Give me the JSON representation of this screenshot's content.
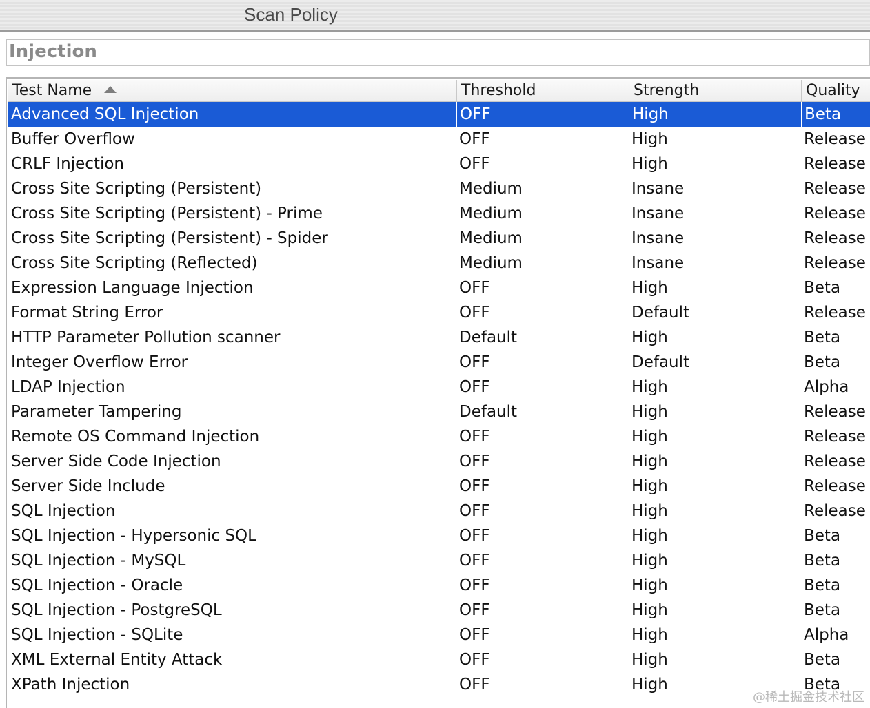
{
  "window": {
    "title": "Scan Policy"
  },
  "category": {
    "title": "Injection"
  },
  "table": {
    "columns": [
      "Test Name",
      "Threshold",
      "Strength",
      "Quality"
    ],
    "sort_icon": "sort-ascending-icon",
    "selected_row": 0,
    "rows": [
      [
        "Advanced SQL Injection",
        "OFF",
        "High",
        "Beta"
      ],
      [
        "Buffer Overflow",
        "OFF",
        "High",
        "Release"
      ],
      [
        "CRLF Injection",
        "OFF",
        "High",
        "Release"
      ],
      [
        "Cross Site Scripting (Persistent)",
        "Medium",
        "Insane",
        "Release"
      ],
      [
        "Cross Site Scripting (Persistent) - Prime",
        "Medium",
        "Insane",
        "Release"
      ],
      [
        "Cross Site Scripting (Persistent) - Spider",
        "Medium",
        "Insane",
        "Release"
      ],
      [
        "Cross Site Scripting (Reflected)",
        "Medium",
        "Insane",
        "Release"
      ],
      [
        "Expression Language Injection",
        "OFF",
        "High",
        "Beta"
      ],
      [
        "Format String Error",
        "OFF",
        "Default",
        "Release"
      ],
      [
        "HTTP Parameter Pollution scanner",
        "Default",
        "High",
        "Beta"
      ],
      [
        "Integer Overflow Error",
        "OFF",
        "Default",
        "Beta"
      ],
      [
        "LDAP Injection",
        "OFF",
        "High",
        "Alpha"
      ],
      [
        "Parameter Tampering",
        "Default",
        "High",
        "Release"
      ],
      [
        "Remote OS Command Injection",
        "OFF",
        "High",
        "Release"
      ],
      [
        "Server Side Code Injection",
        "OFF",
        "High",
        "Release"
      ],
      [
        "Server Side Include",
        "OFF",
        "High",
        "Release"
      ],
      [
        "SQL Injection",
        "OFF",
        "High",
        "Release"
      ],
      [
        "SQL Injection - Hypersonic SQL",
        "OFF",
        "High",
        "Beta"
      ],
      [
        "SQL Injection - MySQL",
        "OFF",
        "High",
        "Beta"
      ],
      [
        "SQL Injection - Oracle",
        "OFF",
        "High",
        "Beta"
      ],
      [
        "SQL Injection - PostgreSQL",
        "OFF",
        "High",
        "Beta"
      ],
      [
        "SQL Injection - SQLite",
        "OFF",
        "High",
        "Alpha"
      ],
      [
        "XML External Entity Attack",
        "OFF",
        "High",
        "Beta"
      ],
      [
        "XPath Injection",
        "OFF",
        "High",
        "Beta"
      ]
    ]
  },
  "watermark": "@稀土掘金技术社区",
  "colors": {
    "selection": "#1a5bd6",
    "selection_text": "#ffffff"
  }
}
